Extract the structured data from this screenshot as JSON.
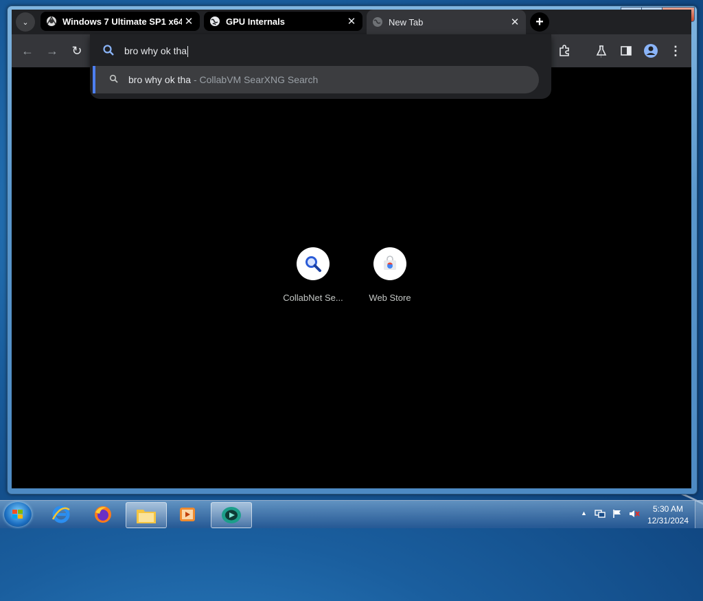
{
  "window": {
    "minimize_glyph": "▁",
    "maximize_glyph": "□",
    "close_glyph": "✕"
  },
  "tabs": [
    {
      "title": "Windows 7 Ultimate SP1 x64 (",
      "icon": "collabvm-icon",
      "active": false
    },
    {
      "title": "GPU Internals",
      "icon": "globe-icon",
      "active": false
    },
    {
      "title": "New Tab",
      "icon": "globe-icon",
      "active": true
    }
  ],
  "tab_close_glyph": "✕",
  "new_tab_glyph": "+",
  "tab_search_glyph": "⌄",
  "toolbar": {
    "back_glyph": "←",
    "forward_glyph": "→",
    "reload_glyph": "↻",
    "menu_glyph": "⋮"
  },
  "omnibox": {
    "value": "bro why ok tha",
    "suggestion": {
      "query": "bro why ok tha",
      "separator": " - ",
      "engine": "CollabVM SearXNG Search"
    }
  },
  "shortcuts": [
    {
      "label": "CollabNet Se...",
      "icon": "search-magnifier-icon"
    },
    {
      "label": "Web Store",
      "icon": "web-store-icon"
    }
  ],
  "taskbar": {
    "items": [
      "internet-explorer-icon",
      "firefox-icon",
      "file-explorer-icon",
      "media-player-icon",
      "active-app-icon"
    ],
    "clock_time": "5:30 AM",
    "clock_date": "12/31/2024",
    "tray_arrow": "▲"
  },
  "colors": {
    "accent": "#4d7ff0",
    "tab_strip": "#202124",
    "toolbar": "#35363a"
  }
}
